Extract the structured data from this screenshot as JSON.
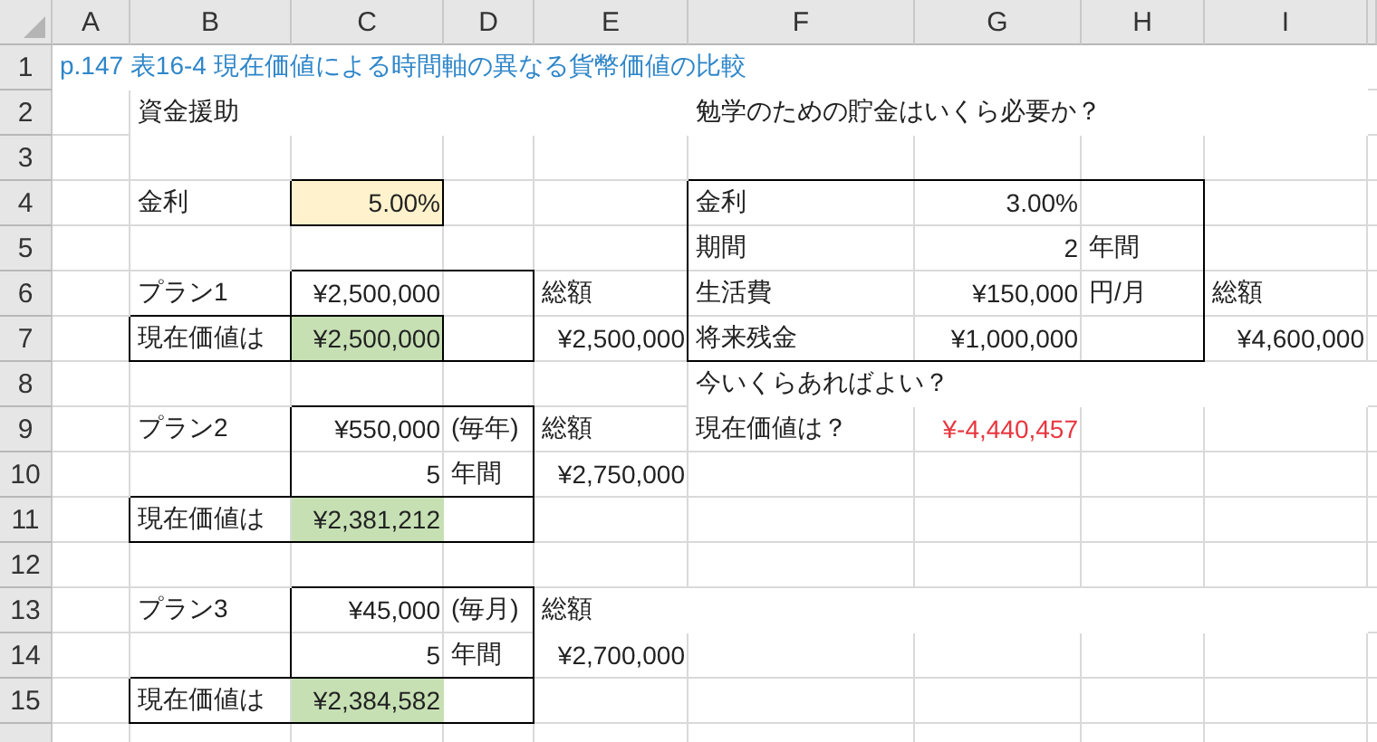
{
  "sheet": {
    "columns": [
      "A",
      "B",
      "C",
      "D",
      "E",
      "F",
      "G",
      "H",
      "I"
    ],
    "rows": [
      {
        "number": "1",
        "cells": [
          {
            "text": "p.147 表16-4 現在価値による時間軸の異なる貨幣価値の比較",
            "kind": "title"
          },
          "",
          "",
          "",
          "",
          "",
          "",
          "",
          ""
        ]
      },
      {
        "number": "2",
        "cells": [
          "",
          {
            "text": "資金援助",
            "kind": "label"
          },
          "",
          "",
          "",
          {
            "text": "勉学のための貯金はいくら必要か？",
            "kind": "label"
          },
          "",
          "",
          ""
        ]
      },
      {
        "number": "3",
        "cells": [
          "",
          "",
          "",
          "",
          "",
          "",
          "",
          "",
          ""
        ]
      },
      {
        "number": "4",
        "cells": [
          "",
          {
            "text": "金利",
            "kind": "label"
          },
          {
            "text": "5.00%",
            "kind": "input"
          },
          "",
          "",
          {
            "text": "金利",
            "kind": "label"
          },
          {
            "text": "3.00%",
            "kind": "number"
          },
          "",
          ""
        ]
      },
      {
        "number": "5",
        "cells": [
          "",
          "",
          "",
          "",
          "",
          {
            "text": "期間",
            "kind": "label"
          },
          {
            "text": "2",
            "kind": "number"
          },
          {
            "text": "年間",
            "kind": "label"
          },
          ""
        ]
      },
      {
        "number": "6",
        "cells": [
          "",
          {
            "text": "プラン1",
            "kind": "label"
          },
          {
            "text": "¥2,500,000",
            "kind": "number"
          },
          "",
          {
            "text": "総額",
            "kind": "label"
          },
          {
            "text": "生活費",
            "kind": "label"
          },
          {
            "text": "¥150,000",
            "kind": "number"
          },
          {
            "text": "円/月",
            "kind": "label"
          },
          {
            "text": "総額",
            "kind": "label"
          }
        ]
      },
      {
        "number": "7",
        "cells": [
          "",
          {
            "text": "現在価値は",
            "kind": "label"
          },
          {
            "text": "¥2,500,000",
            "kind": "result"
          },
          "",
          {
            "text": "¥2,500,000",
            "kind": "number"
          },
          {
            "text": "将来残金",
            "kind": "label"
          },
          {
            "text": "¥1,000,000",
            "kind": "number"
          },
          "",
          {
            "text": "¥4,600,000",
            "kind": "number"
          }
        ]
      },
      {
        "number": "8",
        "cells": [
          "",
          "",
          "",
          "",
          "",
          {
            "text": "今いくらあればよい？",
            "kind": "label"
          },
          "",
          "",
          ""
        ]
      },
      {
        "number": "9",
        "cells": [
          "",
          {
            "text": "プラン2",
            "kind": "label"
          },
          {
            "text": "¥550,000",
            "kind": "number"
          },
          {
            "text": "(毎年)",
            "kind": "label"
          },
          {
            "text": "総額",
            "kind": "label"
          },
          {
            "text": "現在価値は？",
            "kind": "label"
          },
          {
            "text": "¥-4,440,457",
            "kind": "negative"
          },
          "",
          ""
        ]
      },
      {
        "number": "10",
        "cells": [
          "",
          "",
          {
            "text": "5",
            "kind": "number"
          },
          {
            "text": "年間",
            "kind": "label"
          },
          {
            "text": "¥2,750,000",
            "kind": "number"
          },
          "",
          "",
          "",
          ""
        ]
      },
      {
        "number": "11",
        "cells": [
          "",
          {
            "text": "現在価値は",
            "kind": "label"
          },
          {
            "text": "¥2,381,212",
            "kind": "result"
          },
          "",
          "",
          "",
          "",
          "",
          ""
        ]
      },
      {
        "number": "12",
        "cells": [
          "",
          "",
          "",
          "",
          "",
          "",
          "",
          "",
          ""
        ]
      },
      {
        "number": "13",
        "cells": [
          "",
          {
            "text": "プラン3",
            "kind": "label"
          },
          {
            "text": "¥45,000",
            "kind": "number"
          },
          {
            "text": "(毎月)",
            "kind": "label"
          },
          {
            "text": "総額",
            "kind": "label"
          },
          "",
          "",
          "",
          ""
        ]
      },
      {
        "number": "14",
        "cells": [
          "",
          "",
          {
            "text": "5",
            "kind": "number"
          },
          {
            "text": "年間",
            "kind": "label"
          },
          {
            "text": "¥2,700,000",
            "kind": "number"
          },
          "",
          "",
          "",
          ""
        ]
      },
      {
        "number": "15",
        "cells": [
          "",
          {
            "text": "現在価値は",
            "kind": "label"
          },
          {
            "text": "¥2,384,582",
            "kind": "result"
          },
          "",
          "",
          "",
          "",
          "",
          ""
        ]
      }
    ]
  }
}
